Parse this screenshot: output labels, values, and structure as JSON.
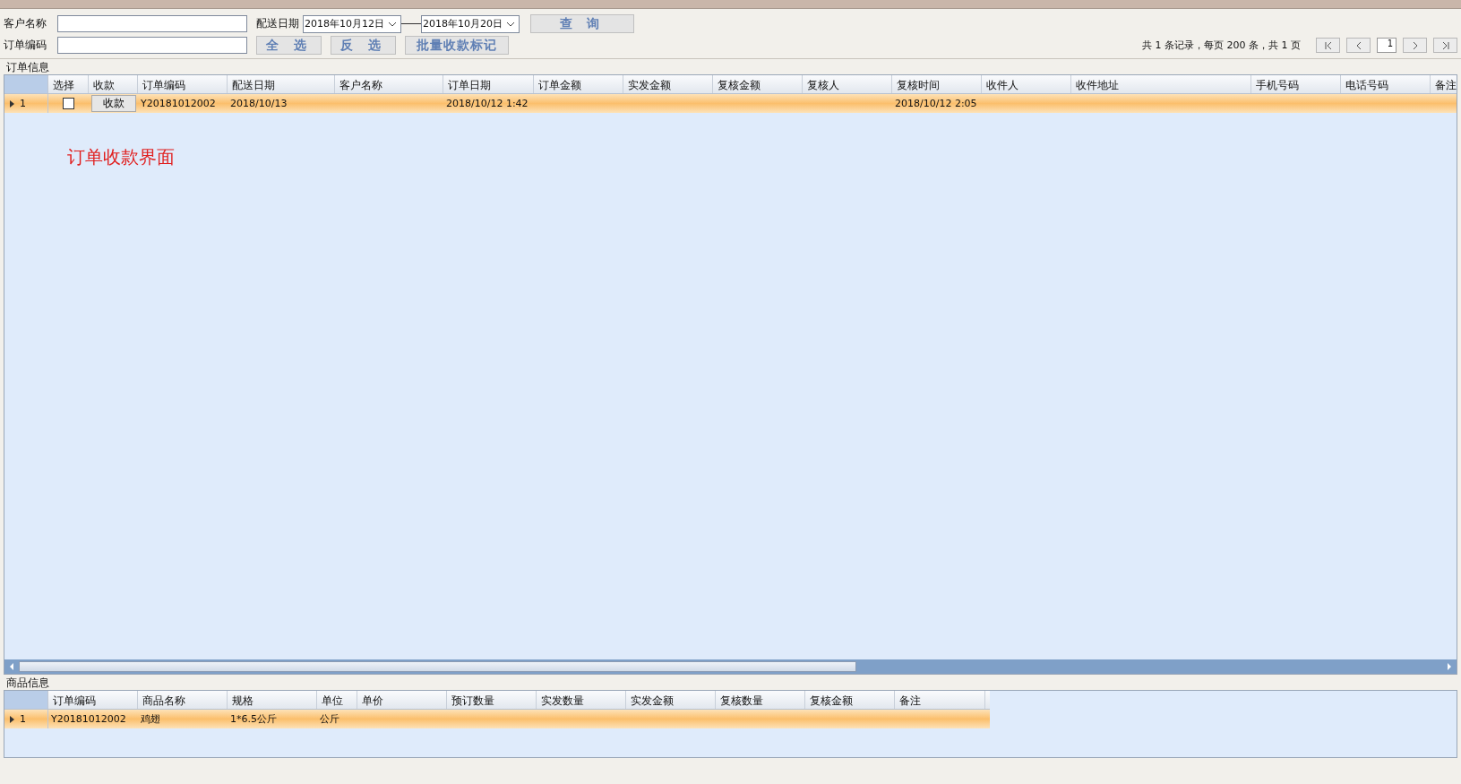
{
  "filters": {
    "customer": {
      "label": "客户名称"
    },
    "order_no": {
      "label": "订单编码"
    },
    "delivery": {
      "label": "配送日期",
      "from": "2018年10月12日",
      "to": "2018年10月20日"
    }
  },
  "buttons": [
    {
      "label": "查 询",
      "kind": "query",
      "disabled": true
    },
    {
      "label": "全 选",
      "kind": "action",
      "disabled": true
    },
    {
      "label": "反 选",
      "kind": "action",
      "disabled": true
    },
    {
      "label": "批量收款标记",
      "kind": "action",
      "disabled": true
    }
  ],
  "pager": {
    "summary": "共 1 条记录，每页 200 条，共 1 页",
    "page": "1"
  },
  "orders": {
    "title": "订单信息",
    "columns": [
      {
        "label": "选择",
        "kind": "check"
      },
      {
        "label": "收款",
        "kind": "button"
      },
      {
        "label": "订单编码",
        "kind": "text"
      },
      {
        "label": "配送日期",
        "kind": "text"
      },
      {
        "label": "客户名称",
        "kind": "text"
      },
      {
        "label": "订单日期",
        "kind": "text"
      },
      {
        "label": "订单金额",
        "kind": "text"
      },
      {
        "label": "实发金额",
        "kind": "text"
      },
      {
        "label": "复核金额",
        "kind": "text"
      },
      {
        "label": "复核人",
        "kind": "text"
      },
      {
        "label": "复核时间",
        "kind": "text"
      },
      {
        "label": "收件人",
        "kind": "text"
      },
      {
        "label": "收件地址",
        "kind": "text"
      },
      {
        "label": "手机号码",
        "kind": "text"
      },
      {
        "label": "电话号码",
        "kind": "text"
      },
      {
        "label": "备注",
        "kind": "text"
      }
    ],
    "rows": [
      {
        "index": "1",
        "selected": true,
        "checked": false,
        "cells": [
          "",
          "收款",
          "Y20181012002",
          "2018/10/13",
          "",
          "2018/10/12 1:42",
          "",
          "",
          "",
          "",
          "2018/10/12 2:05",
          "",
          "",
          "",
          "",
          ""
        ]
      }
    ],
    "annotation": "订单收款界面"
  },
  "goods": {
    "title": "商品信息",
    "columns": [
      "订单编码",
      "商品名称",
      "规格",
      "单位",
      "单价",
      "预订数量",
      "实发数量",
      "实发金额",
      "复核数量",
      "复核金额",
      "备注"
    ],
    "rows": [
      {
        "index": "1",
        "selected": true,
        "cells": [
          "Y20181012002",
          "鸡翅",
          "1*6.5公斤",
          "公斤",
          "",
          "",
          "",
          "",
          "",
          "",
          ""
        ]
      }
    ]
  }
}
